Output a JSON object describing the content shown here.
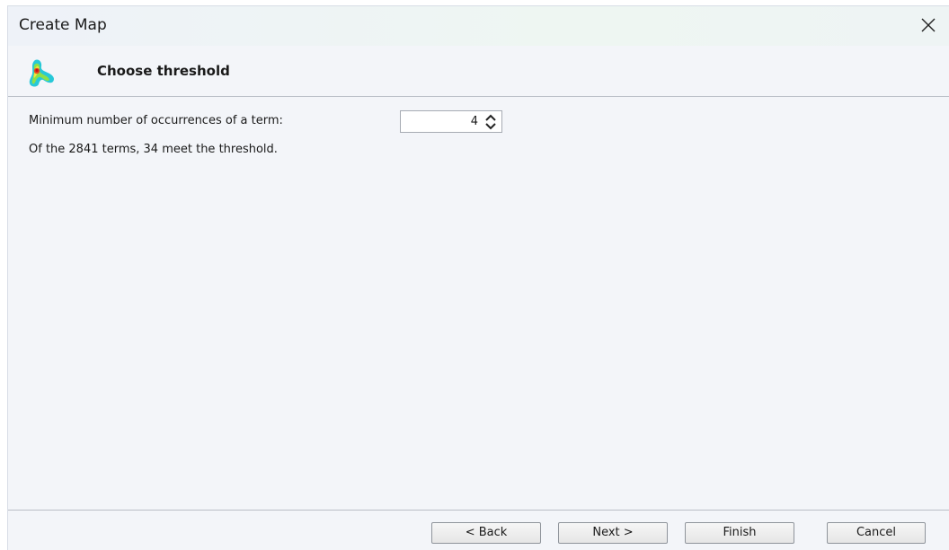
{
  "window": {
    "title": "Create Map"
  },
  "header": {
    "step_title": "Choose threshold",
    "icon": "map-density-icon"
  },
  "threshold": {
    "label": "Minimum number of occurrences of a term:",
    "value": "4",
    "result_text": "Of the 2841 terms, 34 meet the threshold."
  },
  "buttons": {
    "back": "< Back",
    "next": "Next >",
    "finish": "Finish",
    "cancel": "Cancel"
  },
  "colors": {
    "dialog_bg": "#f3f5f9",
    "separator": "#b9bec6"
  }
}
